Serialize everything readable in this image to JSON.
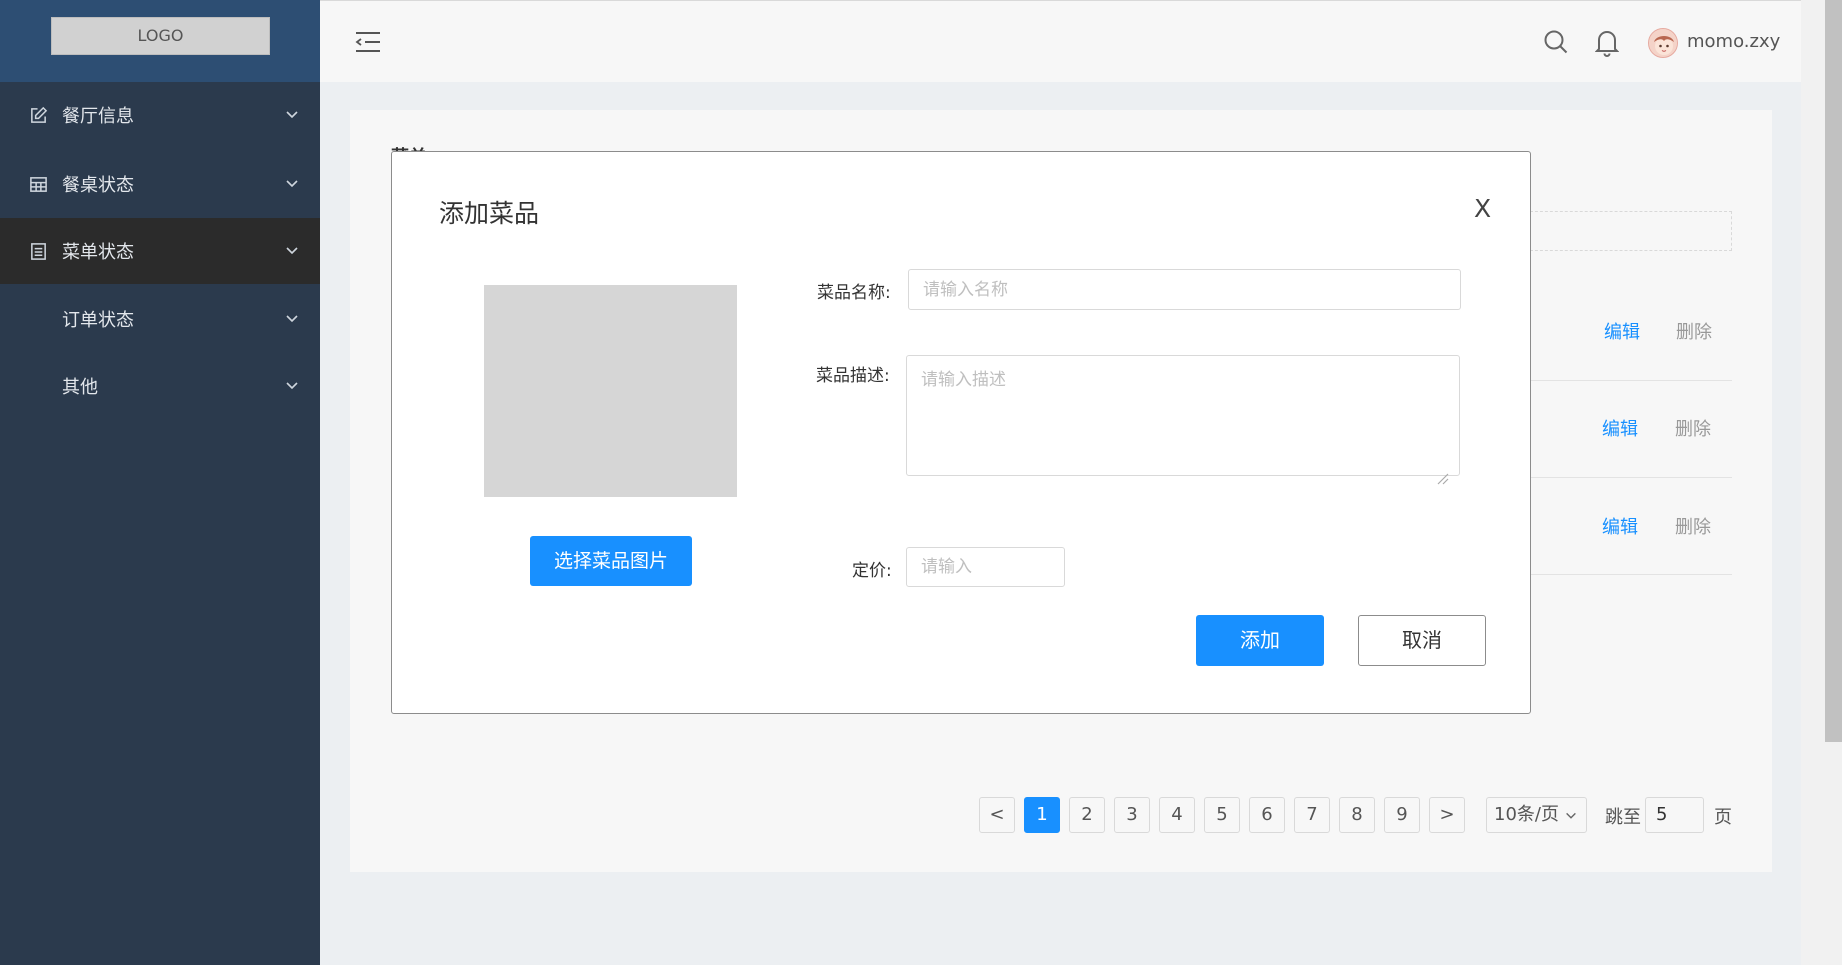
{
  "logo": {
    "text": "LOGO"
  },
  "sidebar": {
    "items": [
      {
        "label": "餐厅信息",
        "icon": "edit-icon"
      },
      {
        "label": "餐桌状态",
        "icon": "table-icon"
      },
      {
        "label": "菜单状态",
        "icon": "list-icon",
        "active": true
      },
      {
        "label": "订单状态"
      },
      {
        "label": "其他"
      }
    ]
  },
  "header": {
    "username": "momo.zxy",
    "icons": [
      "menu-fold-icon",
      "search-icon",
      "bell-icon",
      "avatar"
    ]
  },
  "page": {
    "title": "菜单",
    "rows": [
      {
        "edit": "编辑",
        "delete": "删除"
      },
      {
        "edit": "编辑",
        "delete": "删除"
      },
      {
        "edit": "编辑",
        "delete": "删除"
      }
    ]
  },
  "pagination": {
    "prev": "<",
    "next": ">",
    "pages": [
      "1",
      "2",
      "3",
      "4",
      "5",
      "6",
      "7",
      "8",
      "9"
    ],
    "current": "1",
    "page_size": "10条/页",
    "jump_label": "跳至",
    "jump_value": "5",
    "page_suffix": "页"
  },
  "modal": {
    "title": "添加菜品",
    "close": "X",
    "choose_image": "选择菜品图片",
    "name_label": "菜品名称:",
    "name_placeholder": "请输入名称",
    "desc_label": "菜品描述:",
    "desc_placeholder": "请输入描述",
    "price_label": "定价:",
    "price_placeholder": "请输入",
    "add": "添加",
    "cancel": "取消"
  },
  "colors": {
    "primary": "#1890ff",
    "sidebar": "#2b3a4d",
    "sidebar_active": "#2b2b2b",
    "logo_bg": "#2d4e73"
  }
}
